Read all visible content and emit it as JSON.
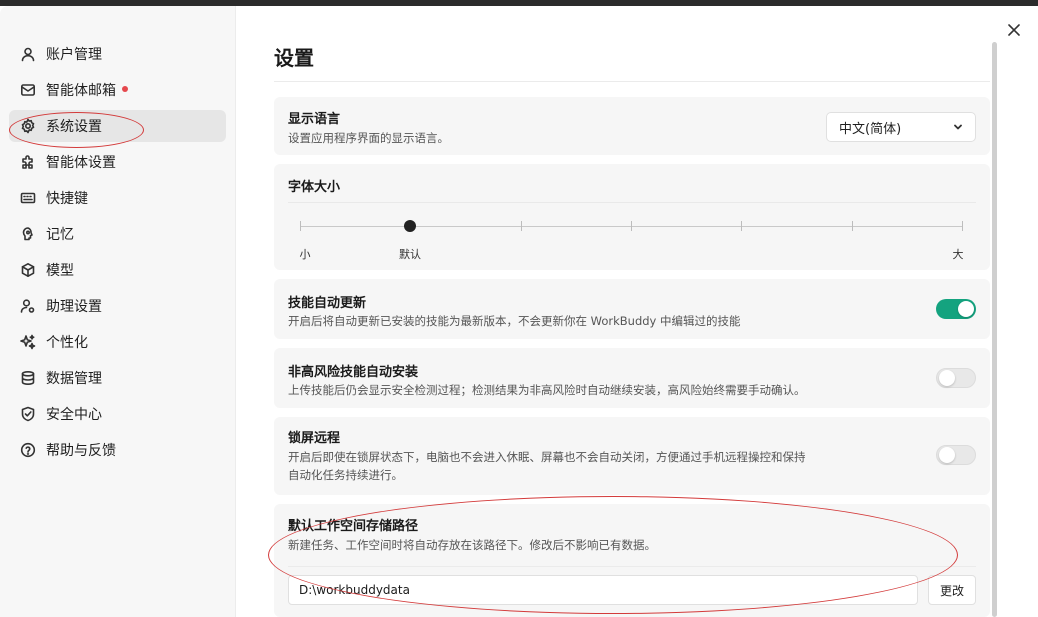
{
  "sidebar": {
    "items": [
      {
        "label": "账户管理",
        "icon": "user-icon"
      },
      {
        "label": "智能体邮箱",
        "icon": "mail-icon",
        "badge_dot": true
      },
      {
        "label": "系统设置",
        "icon": "gear-icon",
        "active": true
      },
      {
        "label": "智能体设置",
        "icon": "puzzle-icon"
      },
      {
        "label": "快捷键",
        "icon": "keyboard-icon"
      },
      {
        "label": "记忆",
        "icon": "brain-icon"
      },
      {
        "label": "模型",
        "icon": "cube-icon"
      },
      {
        "label": "助理设置",
        "icon": "user-gear-icon"
      },
      {
        "label": "个性化",
        "icon": "sparkle-icon"
      },
      {
        "label": "数据管理",
        "icon": "database-icon"
      },
      {
        "label": "安全中心",
        "icon": "shield-icon"
      },
      {
        "label": "帮助与反馈",
        "icon": "help-icon"
      }
    ]
  },
  "main": {
    "title": "设置",
    "language": {
      "title": "显示语言",
      "desc": "设置应用程序界面的显示语言。",
      "selected": "中文(简体)"
    },
    "font_size": {
      "title": "字体大小",
      "min_label": "小",
      "default_label": "默认",
      "max_label": "大",
      "steps": 7,
      "selected_step": 1
    },
    "auto_update_skills": {
      "title": "技能自动更新",
      "desc": "开启后将自动更新已安装的技能为最新版本，不会更新你在 WorkBuddy 中编辑过的技能",
      "enabled": true
    },
    "auto_install_low_risk": {
      "title": "非高风险技能自动安装",
      "desc": "上传技能后仍会显示安全检测过程；检测结果为非高风险时自动继续安装，高风险始终需要手动确认。",
      "enabled": false
    },
    "lock_screen_remote": {
      "title": "锁屏远程",
      "desc_line1": "开启后即使在锁屏状态下，电脑也不会进入休眠、屏幕也不会自动关闭，方便通过手机远程操控和保持",
      "desc_line2": "自动化任务持续进行。",
      "enabled": false
    },
    "workspace_path": {
      "title": "默认工作空间存储路径",
      "desc": "新建任务、工作空间时将自动存放在该路径下。修改后不影响已有数据。",
      "value": "D:\\workbuddydata",
      "change_label": "更改"
    }
  },
  "colors": {
    "accent_toggle": "#14a37f",
    "annotation": "#d33b3b",
    "badge_dot": "#e5484d"
  }
}
